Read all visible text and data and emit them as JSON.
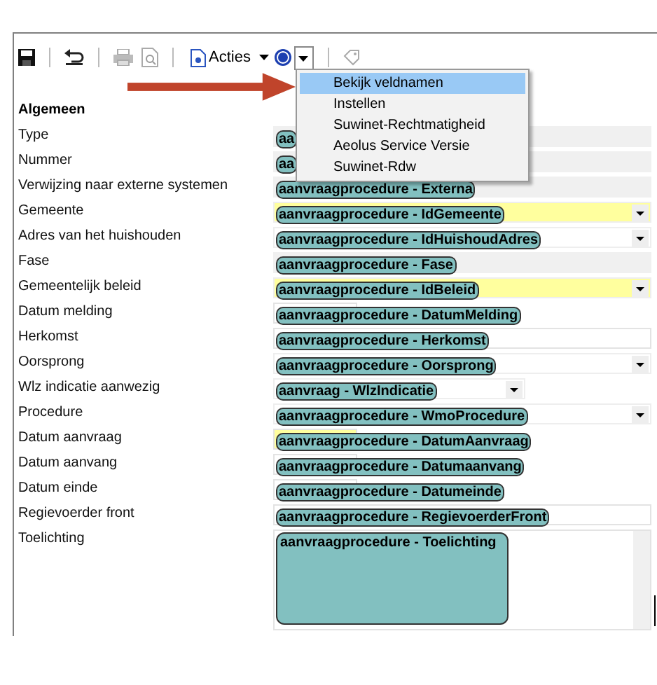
{
  "toolbar": {
    "actions_label": "Acties"
  },
  "help_menu": {
    "items": [
      {
        "label": "Bekijk veldnamen",
        "selected": true
      },
      {
        "label": "Instellen",
        "selected": false
      },
      {
        "label": "Suwinet-Rechtmatigheid",
        "selected": false
      },
      {
        "label": "Aeolus Service Versie",
        "selected": false
      },
      {
        "label": "Suwinet-Rdw",
        "selected": false
      }
    ]
  },
  "section": {
    "title": "Algemeen"
  },
  "fields": [
    {
      "label": "Type",
      "kind": "readonly",
      "required": false,
      "tag": "aa"
    },
    {
      "label": "Nummer",
      "kind": "readonly",
      "required": false,
      "tag": "aa"
    },
    {
      "label": "Verwijzing naar externe systemen",
      "kind": "readonly",
      "required": false,
      "tag": "aanvraagprocedure - Externa"
    },
    {
      "label": "Gemeente",
      "kind": "dropdown",
      "required": true,
      "tag": "aanvraagprocedure - IdGemeente"
    },
    {
      "label": "Adres van het huishouden",
      "kind": "dropdown",
      "required": false,
      "tag": "aanvraagprocedure - IdHuishoudAdres"
    },
    {
      "label": "Fase",
      "kind": "readonly",
      "required": false,
      "tag": "aanvraagprocedure - Fase"
    },
    {
      "label": "Gemeentelijk beleid",
      "kind": "dropdown",
      "required": true,
      "tag": "aanvraagprocedure - IdBeleid"
    },
    {
      "label": "Datum melding",
      "kind": "date",
      "required": false,
      "tag": "aanvraagprocedure - DatumMelding"
    },
    {
      "label": "Herkomst",
      "kind": "text",
      "required": false,
      "tag": "aanvraagprocedure - Herkomst"
    },
    {
      "label": "Oorsprong",
      "kind": "dropdown",
      "required": false,
      "tag": "aanvraagprocedure - Oorsprong"
    },
    {
      "label": "Wlz indicatie aanwezig",
      "kind": "short-dropdown",
      "required": false,
      "tag": "aanvraag - WlzIndicatie"
    },
    {
      "label": "Procedure",
      "kind": "dropdown",
      "required": false,
      "tag": "aanvraagprocedure - WmoProcedure"
    },
    {
      "label": "Datum aanvraag",
      "kind": "date",
      "required": true,
      "tag": "aanvraagprocedure - DatumAanvraag"
    },
    {
      "label": "Datum aanvang",
      "kind": "date",
      "required": false,
      "tag": "aanvraagprocedure - Datumaanvang"
    },
    {
      "label": "Datum einde",
      "kind": "date",
      "required": false,
      "tag": "aanvraagprocedure - Datumeinde"
    },
    {
      "label": "Regievoerder front",
      "kind": "text",
      "required": false,
      "tag": "aanvraagprocedure - RegievoerderFront"
    },
    {
      "label": "Toelichting",
      "kind": "textarea",
      "required": false,
      "tag": "aanvraagprocedure - Toelichting"
    }
  ]
}
